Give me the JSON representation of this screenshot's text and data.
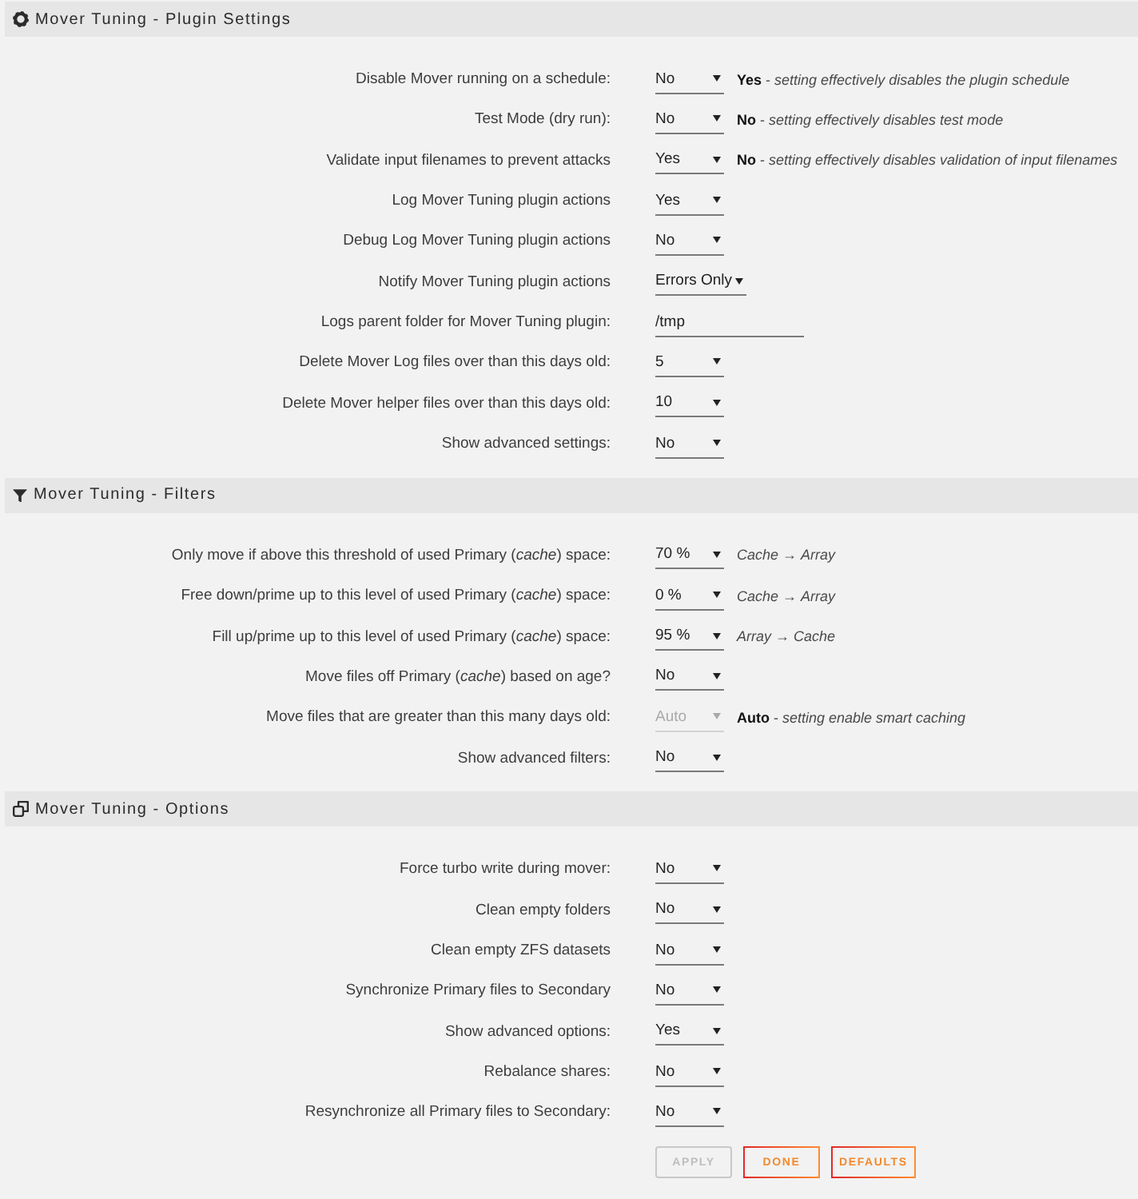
{
  "sections": [
    {
      "title": "Mover Tuning - Plugin Settings",
      "settings": [
        {
          "label": "Disable Mover running on a schedule:",
          "kind": "select",
          "value": "No",
          "disabled": false,
          "note": "**Yes** - *setting effectively disables the plugin schedule*"
        },
        {
          "label": "Test Mode (dry run):",
          "kind": "select",
          "value": "No",
          "disabled": false,
          "note": "**No** - *setting effectively disables test mode*"
        },
        {
          "label": "Validate input filenames to prevent attacks",
          "kind": "select",
          "value": "Yes",
          "disabled": false,
          "note": "**No** - *setting effectively disables validation of input filenames*"
        },
        {
          "label": "Log Mover Tuning plugin actions",
          "kind": "select",
          "value": "Yes",
          "disabled": false
        },
        {
          "label": "Debug Log Mover Tuning plugin actions",
          "kind": "select",
          "value": "No",
          "disabled": false
        },
        {
          "label": "Notify Mover Tuning plugin actions",
          "kind": "select",
          "value": "Errors Only",
          "disabled": false
        },
        {
          "label": "Logs parent folder for Mover Tuning plugin:",
          "kind": "text",
          "value": "/tmp",
          "disabled": false
        },
        {
          "label": "Delete Mover Log files over than this days old:",
          "kind": "select",
          "value": "5",
          "disabled": false
        },
        {
          "label": "Delete Mover helper files over than this days old:",
          "kind": "select",
          "value": "10",
          "disabled": false
        },
        {
          "label": "Show advanced settings:",
          "kind": "select",
          "value": "No",
          "disabled": false
        }
      ]
    },
    {
      "title": "Mover Tuning - Filters",
      "settings": [
        {
          "label": "Only move if above this threshold of used Primary (*cache*) space:",
          "kind": "select",
          "value": "70 %",
          "disabled": false,
          "note": "*Cache* → *Array*"
        },
        {
          "label": "Free down/prime up to this level of used Primary (*cache*) space:",
          "kind": "select",
          "value": "0 %",
          "disabled": false,
          "note": "*Cache* → *Array*"
        },
        {
          "label": "Fill up/prime up to this level of used Primary (*cache*) space:",
          "kind": "select",
          "value": "95 %",
          "disabled": false,
          "note": "*Array* → *Cache*"
        },
        {
          "label": "Move files off Primary (*cache*) based on age?",
          "kind": "select",
          "value": "No",
          "disabled": false
        },
        {
          "label": "Move files that are greater than this many days old:",
          "kind": "select",
          "value": "Auto",
          "disabled": true,
          "note": "**Auto** - *setting enable smart caching*"
        },
        {
          "label": "Show advanced filters:",
          "kind": "select",
          "value": "No",
          "disabled": false
        }
      ]
    },
    {
      "title": "Mover Tuning - Options",
      "settings": [
        {
          "label": "Force turbo write during mover:",
          "kind": "select",
          "value": "No",
          "disabled": false
        },
        {
          "label": "Clean empty folders",
          "kind": "select",
          "value": "No",
          "disabled": false
        },
        {
          "label": "Clean empty ZFS datasets",
          "kind": "select",
          "value": "No",
          "disabled": false
        },
        {
          "label": "Synchronize Primary files to Secondary",
          "kind": "select",
          "value": "No",
          "disabled": false
        },
        {
          "label": "Show advanced options:",
          "kind": "select",
          "value": "Yes",
          "disabled": false
        },
        {
          "label": "Rebalance shares:",
          "kind": "select",
          "value": "No",
          "disabled": false
        },
        {
          "label": "Resynchronize all Primary files to Secondary:",
          "kind": "select",
          "value": "No",
          "disabled": false
        }
      ]
    }
  ],
  "buttons": [
    {
      "label": "APPLY",
      "disabled": true
    },
    {
      "label": "DONE",
      "disabled": false
    },
    {
      "label": "DEFAULTS",
      "disabled": false
    }
  ]
}
